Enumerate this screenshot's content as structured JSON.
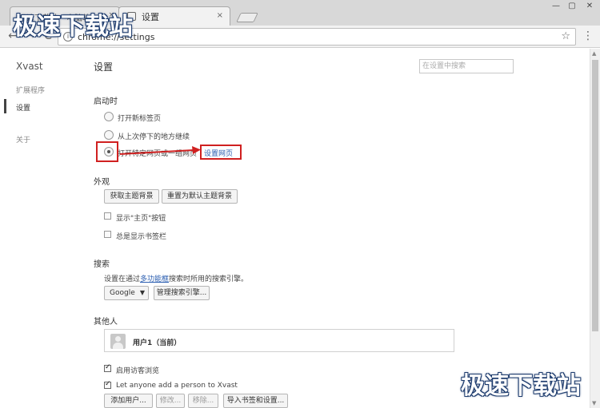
{
  "window": {
    "tab_inactive_title": "极速下载站 - 电脑软",
    "tab_active_title": "设置",
    "tab_close": "×",
    "controls": {
      "minimize": "—",
      "maximize": "▢",
      "close": "✕"
    }
  },
  "toolbar": {
    "back": "←",
    "forward": "→",
    "reload": "C",
    "info": "i",
    "url": "chrome://settings",
    "star": "☆",
    "menu": "⋮"
  },
  "sidebar": {
    "brand": "Xvast",
    "items": [
      {
        "label": "扩展程序"
      },
      {
        "label": "设置"
      },
      {
        "label": "关于"
      }
    ]
  },
  "main": {
    "title": "设置",
    "search_placeholder": "在设置中搜索",
    "startup": {
      "title": "启动时",
      "options": [
        {
          "label": "打开新标签页",
          "checked": false
        },
        {
          "label": "从上次停下的地方继续",
          "checked": false
        },
        {
          "label": "打开特定网页或一组网页",
          "checked": true
        }
      ],
      "set_pages_link": "设置网页"
    },
    "appearance": {
      "title": "外观",
      "get_themes": "获取主题背景",
      "reset_theme": "重置为默认主题背景",
      "show_home_button": "显示\"主页\"按钮",
      "show_bookmarks_bar": "总是显示书签栏"
    },
    "search": {
      "title": "搜索",
      "desc_before": "设置在通过",
      "desc_link": "多功能框",
      "desc_after": "搜索时所用的搜索引擎。",
      "engine": "Google",
      "manage_engines": "管理搜索引擎..."
    },
    "people": {
      "title": "其他人",
      "user_name": "用户1（当前）",
      "guest_browsing": "启用访客浏览",
      "let_anyone_add": "Let anyone add a person to Xvast",
      "add_user": "添加用户...",
      "edit": "修改...",
      "remove": "移除...",
      "import": "导入书签和设置..."
    }
  },
  "watermarks": {
    "top": "极速下载站",
    "bottom": "极速下载站"
  },
  "colors": {
    "highlight": "#d02020",
    "link": "#2a5db0",
    "watermark_outline": "#1e3c6e"
  }
}
